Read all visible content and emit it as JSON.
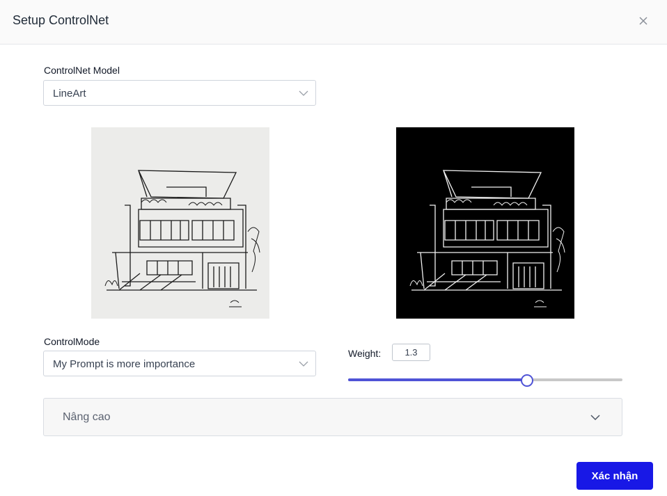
{
  "dialog": {
    "title": "Setup ControlNet"
  },
  "model": {
    "label": "ControlNet Model",
    "value": "LineArt"
  },
  "mode": {
    "label": "ControlMode",
    "value": "My Prompt is more importance"
  },
  "weight": {
    "label": "Weight:",
    "value": "1.3",
    "slider_fraction": 0.65
  },
  "advanced": {
    "label": "Nâng cao"
  },
  "confirm": {
    "label": "Xác nhận"
  },
  "colors": {
    "accent": "#4f53d6",
    "primary_button": "#1818e6"
  },
  "icons": {
    "close": "close-icon",
    "select_chevron": "chevron-down-icon",
    "advanced_chevron": "chevron-down-icon"
  }
}
